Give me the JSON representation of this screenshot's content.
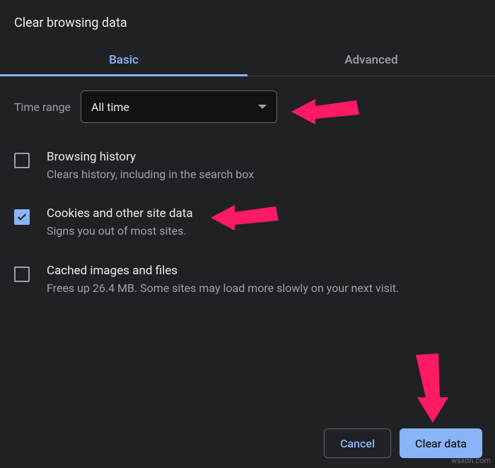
{
  "title": "Clear browsing data",
  "tabs": {
    "basic": "Basic",
    "advanced": "Advanced"
  },
  "timeRange": {
    "label": "Time range",
    "value": "All time"
  },
  "options": [
    {
      "title": "Browsing history",
      "desc": "Clears history, including in the search box",
      "checked": false
    },
    {
      "title": "Cookies and other site data",
      "desc": "Signs you out of most sites.",
      "checked": true
    },
    {
      "title": "Cached images and files",
      "desc": "Frees up 26.4 MB. Some sites may load more slowly on your next visit.",
      "checked": false
    }
  ],
  "buttons": {
    "cancel": "Cancel",
    "confirm": "Clear data"
  },
  "annotations": {
    "arrowColor": "#ff1a66"
  },
  "watermark": "wsxdn.com"
}
